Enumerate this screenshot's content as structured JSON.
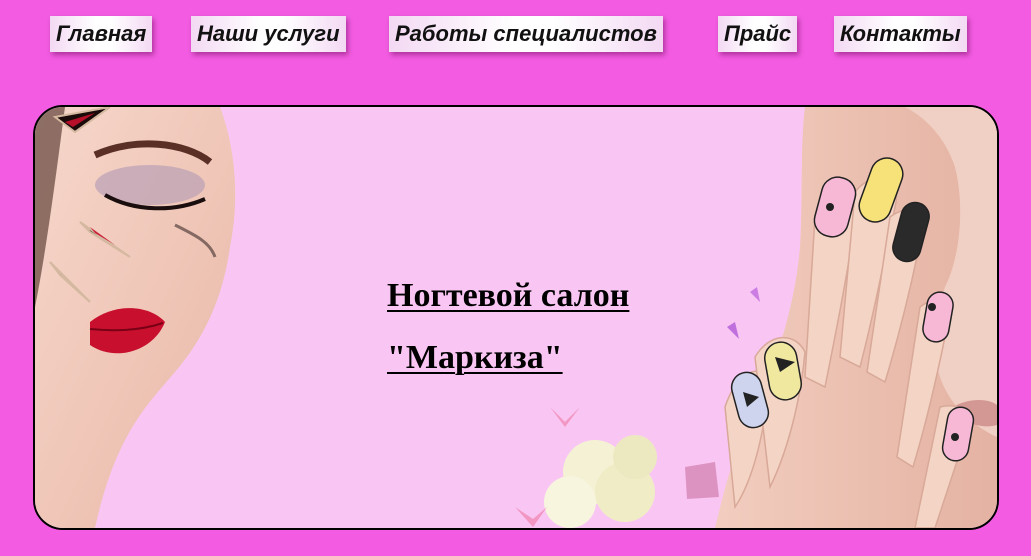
{
  "nav": {
    "items": [
      {
        "id": "home",
        "label": "Главная"
      },
      {
        "id": "services",
        "label": "Наши услуги"
      },
      {
        "id": "works",
        "label": "Работы специалистов"
      },
      {
        "id": "price",
        "label": "Прайс"
      },
      {
        "id": "contacts",
        "label": "Контакты"
      }
    ]
  },
  "banner": {
    "title_line1": "Ногтевой салон",
    "title_line2": "\"Маркиза\""
  },
  "colors": {
    "page_background": "#f35ce2",
    "banner_background": "#f9c6f4",
    "nav_button": "#ffffff",
    "text": "#000000"
  }
}
